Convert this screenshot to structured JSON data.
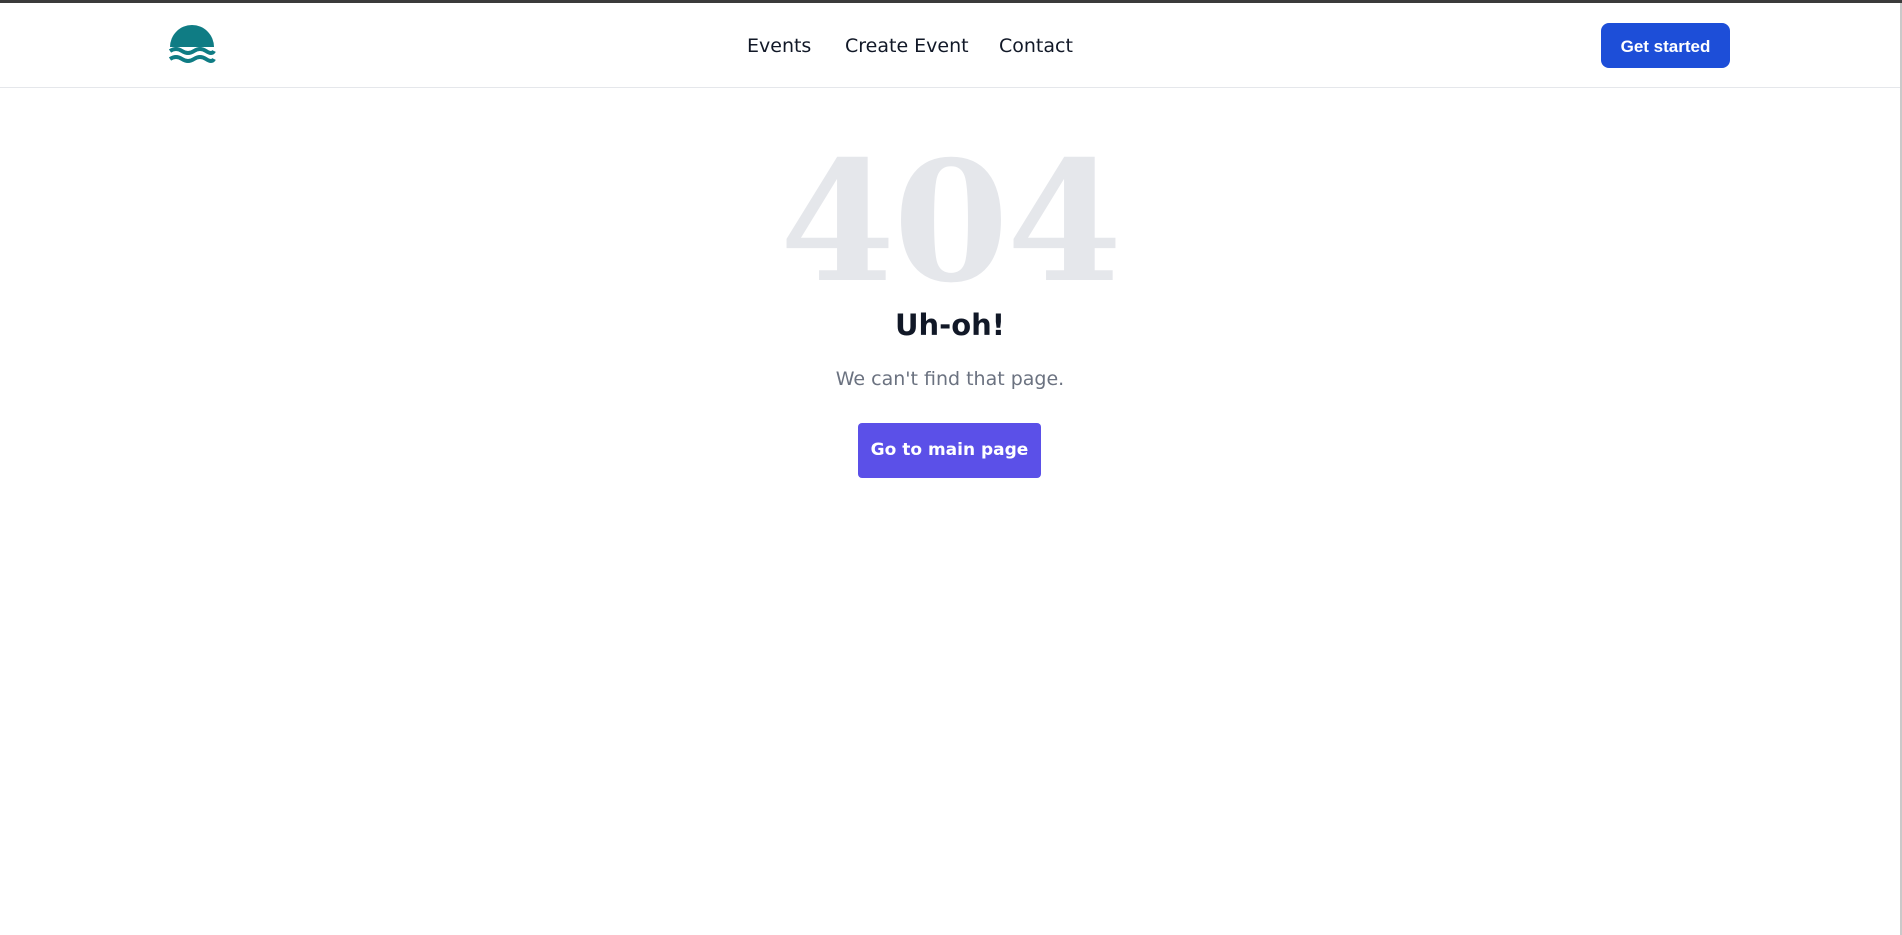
{
  "header": {
    "logo_icon": "waves-logo-icon",
    "logo_color": "#0f7c84",
    "nav": {
      "events": "Events",
      "create_event": "Create Event",
      "contact": "Contact"
    },
    "cta_label": "Get started",
    "cta_color": "#1d4ed8"
  },
  "main": {
    "code": "404",
    "title": "Uh-oh!",
    "message": "We can't find that page.",
    "button_label": "Go to main page",
    "button_color": "#5b50e8"
  }
}
